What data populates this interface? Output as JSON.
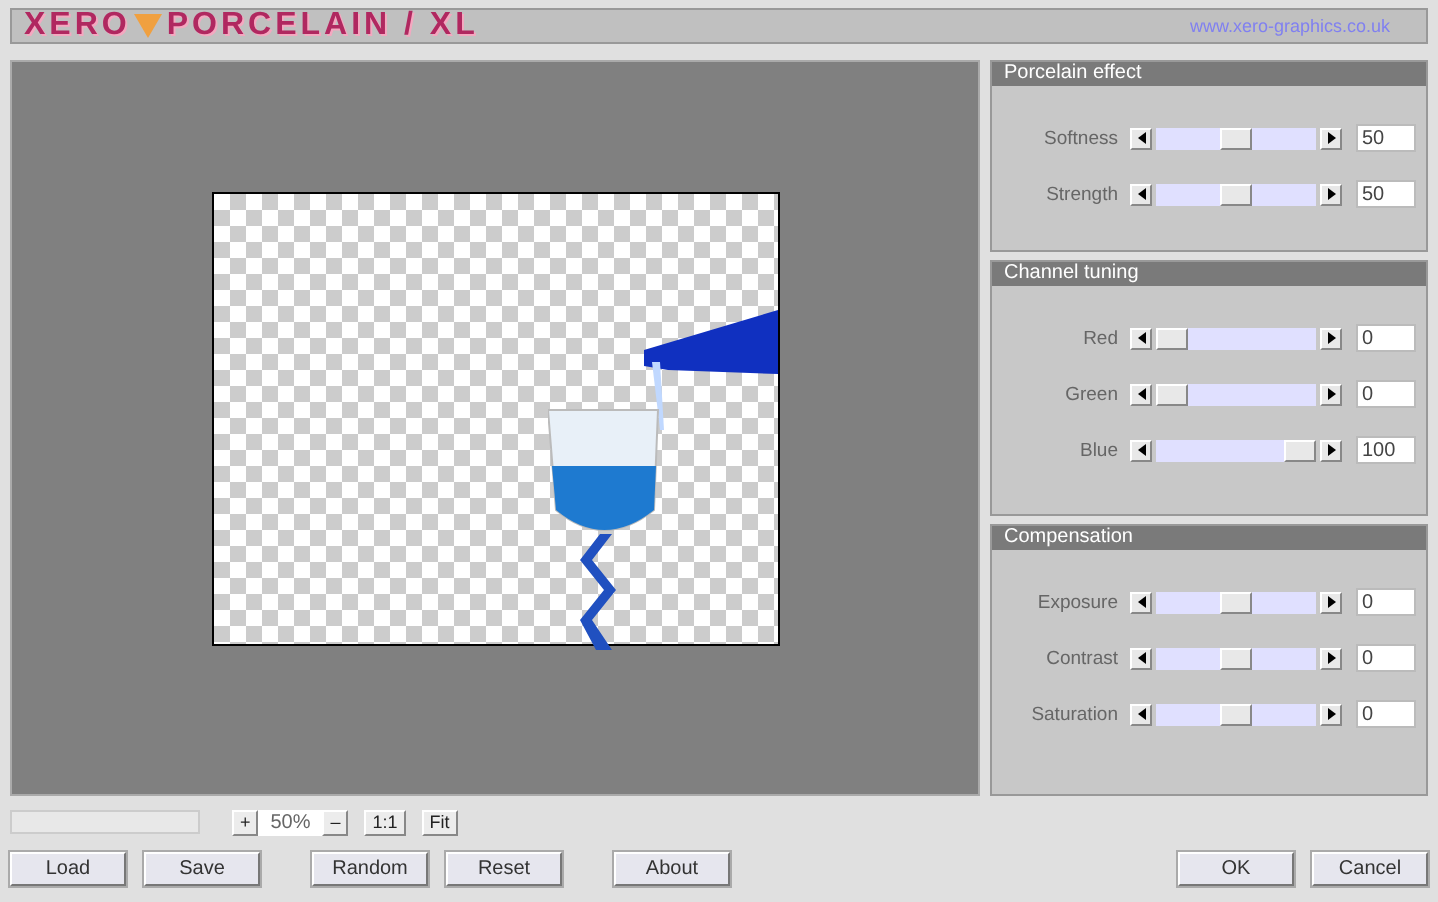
{
  "header": {
    "logo_left": "XERO",
    "logo_right": "PORCELAIN / XL",
    "link": "www.xero-graphics.co.uk"
  },
  "panels": [
    {
      "title": "Porcelain effect",
      "sliders": [
        {
          "label": "Softness",
          "level": 0.5,
          "value": "50"
        },
        {
          "label": "Strength",
          "level": 0.5,
          "value": "50"
        }
      ]
    },
    {
      "title": "Channel tuning",
      "sliders": [
        {
          "label": "Red",
          "level": 0,
          "value": "0"
        },
        {
          "label": "Green",
          "level": 0,
          "value": "0"
        },
        {
          "label": "Blue",
          "level": 1,
          "value": "100"
        }
      ]
    },
    {
      "title": "Compensation",
      "sliders": [
        {
          "label": "Exposure",
          "level": 0.5,
          "value": "0"
        },
        {
          "label": "Contrast",
          "level": 0.5,
          "value": "0"
        },
        {
          "label": "Saturation",
          "level": 0.5,
          "value": "0"
        }
      ]
    }
  ],
  "zoom": {
    "plus": "+",
    "value": "50%",
    "minus": "–",
    "actual": "1:1",
    "fit": "Fit"
  },
  "left_buttons": [
    "Load",
    "Save",
    "Random",
    "Reset",
    "About"
  ],
  "right_buttons": [
    "OK",
    "Cancel"
  ]
}
